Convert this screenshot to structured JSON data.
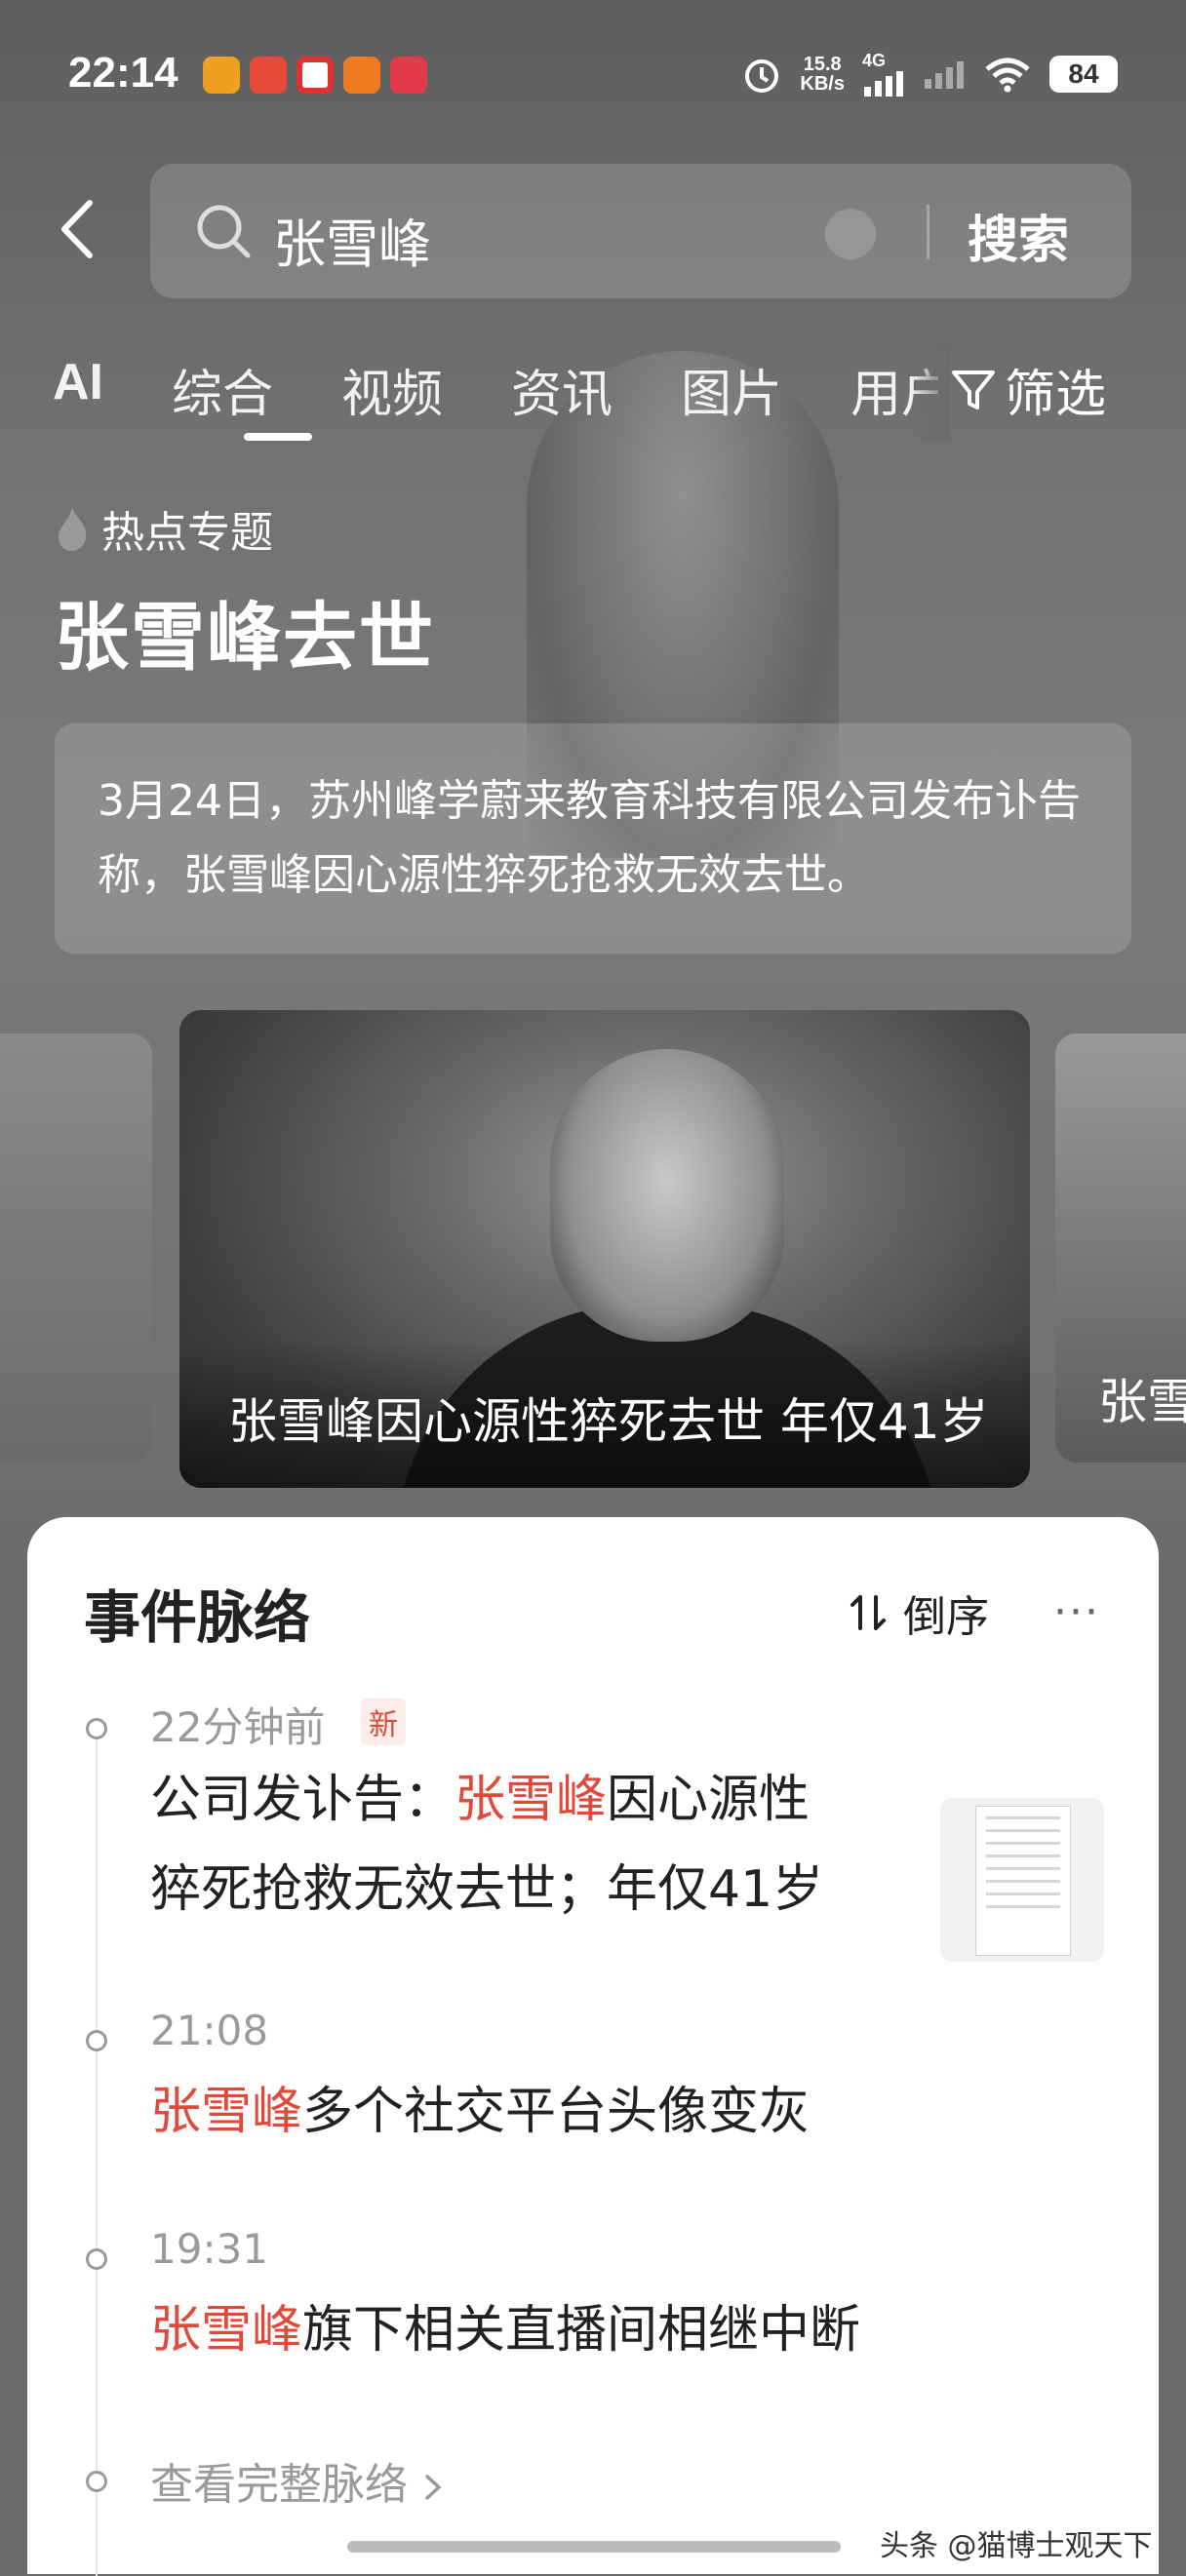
{
  "status_bar": {
    "time": "22:14",
    "speed_top": "15.8",
    "speed_bottom": "KB/s",
    "network": "4G",
    "battery": "84",
    "app_colors": [
      "#f0a020",
      "#e84a3a",
      "#e03030",
      "#f07a20",
      "#e23a4a"
    ]
  },
  "search": {
    "query": "张雪峰",
    "button_label": "搜索"
  },
  "tabs": {
    "items": [
      "AI",
      "综合",
      "视频",
      "资讯",
      "图片",
      "用户"
    ],
    "active": "综合",
    "filter_label": "筛选"
  },
  "topic": {
    "badge": "热点专题",
    "title": "张雪峰去世",
    "summary": "3月24日，苏州峰学蔚来教育科技有限公司发布讣告称，张雪峰因心源性猝死抢救无效去世。"
  },
  "carousel": {
    "main_caption": "张雪峰因心源性猝死去世 年仅41岁",
    "side_caption": "张雪"
  },
  "timeline": {
    "title": "事件脉络",
    "sort_label": "倒序",
    "more": "···",
    "items": [
      {
        "time": "22分钟前",
        "badge": "新",
        "highlight": "张雪峰",
        "prefix": "公司发讣告：",
        "rest_line1": "因心源性",
        "line2": "猝死抢救无效去世；年仅41岁"
      },
      {
        "time": "21:08",
        "highlight": "张雪峰",
        "rest": "多个社交平台头像变灰"
      },
      {
        "time": "19:31",
        "highlight": "张雪峰",
        "rest": "旗下相关直播间相继中断"
      }
    ],
    "view_full": "查看完整脉络"
  },
  "watermark": "头条 @猫博士观天下",
  "colors": {
    "accent": "#e04a3a",
    "overlay_bg": "#6b6b6b"
  }
}
